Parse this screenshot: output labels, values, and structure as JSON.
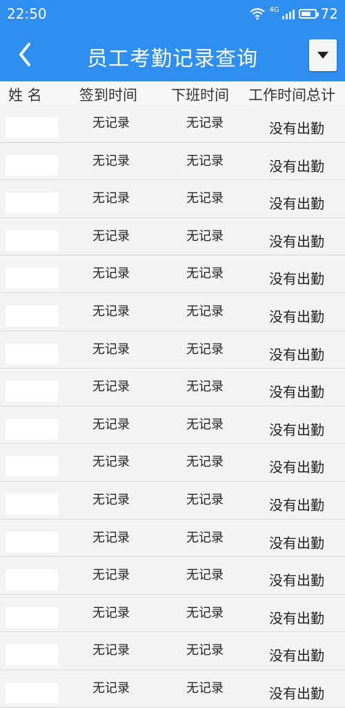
{
  "status_bar": {
    "time": "22:50",
    "network": "4G",
    "battery": "72"
  },
  "app_bar": {
    "title": "员工考勤记录查询"
  },
  "table": {
    "headers": [
      "姓 名",
      "签到时间",
      "下班时间",
      "工作时间总计"
    ],
    "rows": [
      {
        "sign_in": "无记录",
        "sign_out": "无记录",
        "total": "没有出勤"
      },
      {
        "sign_in": "无记录",
        "sign_out": "无记录",
        "total": "没有出勤"
      },
      {
        "sign_in": "无记录",
        "sign_out": "无记录",
        "total": "没有出勤"
      },
      {
        "sign_in": "无记录",
        "sign_out": "无记录",
        "total": "没有出勤"
      },
      {
        "sign_in": "无记录",
        "sign_out": "无记录",
        "total": "没有出勤"
      },
      {
        "sign_in": "无记录",
        "sign_out": "无记录",
        "total": "没有出勤"
      },
      {
        "sign_in": "无记录",
        "sign_out": "无记录",
        "total": "没有出勤"
      },
      {
        "sign_in": "无记录",
        "sign_out": "无记录",
        "total": "没有出勤"
      },
      {
        "sign_in": "无记录",
        "sign_out": "无记录",
        "total": "没有出勤"
      },
      {
        "sign_in": "无记录",
        "sign_out": "无记录",
        "total": "没有出勤"
      },
      {
        "sign_in": "无记录",
        "sign_out": "无记录",
        "total": "没有出勤"
      },
      {
        "sign_in": "无记录",
        "sign_out": "无记录",
        "total": "没有出勤"
      },
      {
        "sign_in": "无记录",
        "sign_out": "无记录",
        "total": "没有出勤"
      },
      {
        "sign_in": "无记录",
        "sign_out": "无记录",
        "total": "没有出勤"
      },
      {
        "sign_in": "无记录",
        "sign_out": "无记录",
        "total": "没有出勤"
      },
      {
        "sign_in": "无记录",
        "sign_out": "无记录",
        "total": "没有出勤"
      }
    ]
  },
  "colors": {
    "app_bar": "#2f8ff0",
    "background": "#f2f2f2"
  },
  "icons": {
    "back": "chevron-left-icon",
    "menu": "dropdown-triangle-icon"
  }
}
